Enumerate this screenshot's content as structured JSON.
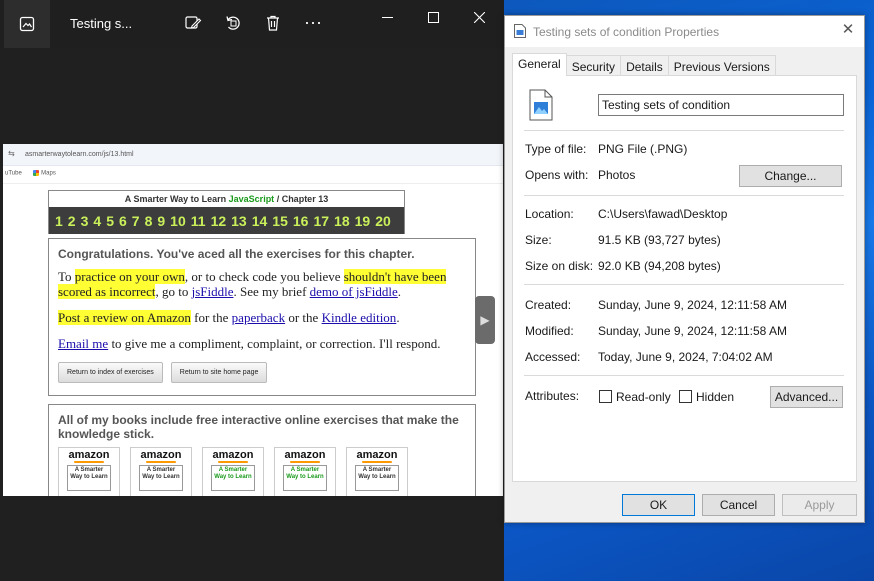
{
  "photos": {
    "title": "Testing s...",
    "icons": [
      "photos-app-icon",
      "edit-icon",
      "rotate-icon",
      "delete-icon",
      "more-icon"
    ],
    "more_label": "···",
    "window_controls": [
      "minimize",
      "maximize",
      "close"
    ]
  },
  "webpage": {
    "url": "asmarterwaytolearn.com/js/13.html",
    "bookmarks": [
      "uTube",
      "Maps"
    ],
    "header_prefix": "A Smarter Way to Learn ",
    "header_js": "JavaScript",
    "header_suffix": "  /  Chapter 13",
    "chapters": [
      "1",
      "2",
      "3",
      "4",
      "5",
      "6",
      "7",
      "8",
      "9",
      "10",
      "11",
      "12",
      "13",
      "14",
      "15",
      "16",
      "17",
      "18",
      "19",
      "20"
    ],
    "congrats": "Congratulations. You've aced all the exercises for this chapter.",
    "p1": {
      "t1": "To ",
      "h1": "practice on your own",
      "t2": ", or to check code you believe ",
      "h2": "shouldn't have been scored as incorrect",
      "t3": ", go to ",
      "l1": "jsFiddle",
      "t4": ". See my brief ",
      "l2": "demo of jsFiddle",
      "t5": "."
    },
    "p2": {
      "h1": "Post a review on Amazon",
      "t1": " for the ",
      "l1": "paperback",
      "t2": " or the ",
      "l2": "Kindle edition",
      "t3": "."
    },
    "p3": {
      "l1": "Email me",
      "t1": " to give me a compliment, complaint, or correction. I'll respond."
    },
    "btn_index": "Return to index of exercises",
    "btn_home": "Return to site home page",
    "books_heading": "All of my books include free interactive online exercises that make the knowledge stick.",
    "books": [
      {
        "brand": "amazon",
        "cover": "A Smarter Way to Learn",
        "green": false
      },
      {
        "brand": "amazon",
        "cover": "A Smarter Way to Learn",
        "green": false
      },
      {
        "brand": "amazon",
        "cover": "A Smarter Way to Learn",
        "green": true
      },
      {
        "brand": "amazon",
        "cover": "A Smarter Way to Learn",
        "green": true
      },
      {
        "brand": "amazon",
        "cover": "A Smarter Way to Learn",
        "green": false
      }
    ]
  },
  "props": {
    "title": "Testing sets of condition Properties",
    "tabs": [
      "General",
      "Security",
      "Details",
      "Previous Versions"
    ],
    "filename": "Testing sets of condition",
    "type_label": "Type of file:",
    "type_value": "PNG File (.PNG)",
    "opens_label": "Opens with:",
    "opens_value": "Photos",
    "change_btn": "Change...",
    "location_label": "Location:",
    "location_value": "C:\\Users\\fawad\\Desktop",
    "size_label": "Size:",
    "size_value": "91.5 KB (93,727 bytes)",
    "sizeondisk_label": "Size on disk:",
    "sizeondisk_value": "92.0 KB (94,208 bytes)",
    "created_label": "Created:",
    "created_value": "Sunday, June 9, 2024, 12:11:58 AM",
    "modified_label": "Modified:",
    "modified_value": "Sunday, June 9, 2024, 12:11:58 AM",
    "accessed_label": "Accessed:",
    "accessed_value": "Today, June 9, 2024, 7:04:02 AM",
    "attributes_label": "Attributes:",
    "readonly_label": "Read-only",
    "hidden_label": "Hidden",
    "advanced_btn": "Advanced...",
    "ok_btn": "OK",
    "cancel_btn": "Cancel",
    "apply_btn": "Apply"
  }
}
